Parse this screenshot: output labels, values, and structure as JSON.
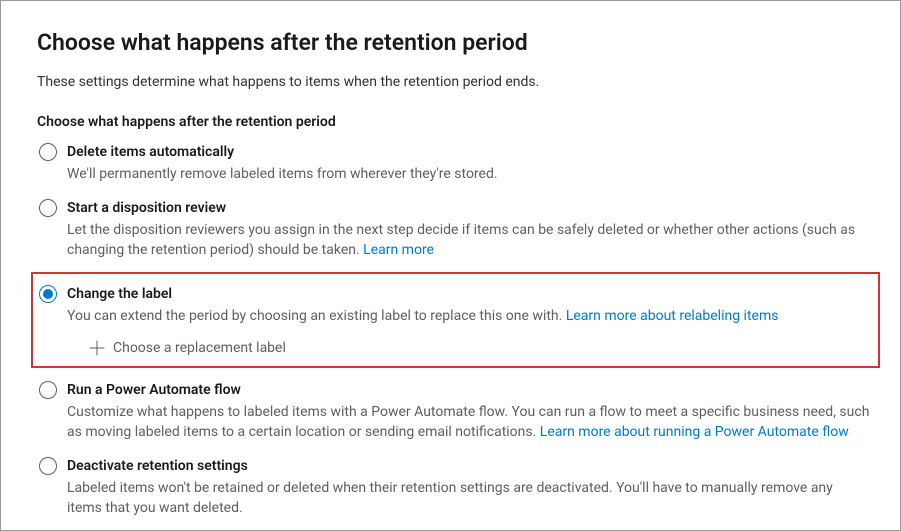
{
  "header": {
    "title": "Choose what happens after the retention period",
    "subtitle": "These settings determine what happens to items when the retention period ends."
  },
  "section": {
    "label": "Choose what happens after the retention period"
  },
  "options": {
    "delete": {
      "title": "Delete items automatically",
      "desc": "We'll permanently remove labeled items from wherever they're stored."
    },
    "disposition": {
      "title": "Start a disposition review",
      "desc_prefix": "Let the disposition reviewers you assign in the next step decide if items can be safely deleted or whether other actions (such as changing the retention period) should be taken.  ",
      "learn_more": "Learn more"
    },
    "change_label": {
      "title": "Change the label",
      "desc_prefix": "You can extend the period by choosing an existing label to replace this one with. ",
      "learn_more": "Learn more about relabeling items",
      "choose_replacement": "Choose a replacement label"
    },
    "power_automate": {
      "title": "Run a Power Automate flow",
      "desc_prefix": "Customize what happens to labeled items with a Power Automate flow. You can run a flow to meet a specific business need, such as moving labeled items to a certain location or sending email notifications. ",
      "learn_more": "Learn more about running a Power Automate flow"
    },
    "deactivate": {
      "title": "Deactivate retention settings",
      "desc": "Labeled items won't be retained or deleted when their retention settings are deactivated. You'll have to manually remove any items that you want deleted."
    }
  }
}
